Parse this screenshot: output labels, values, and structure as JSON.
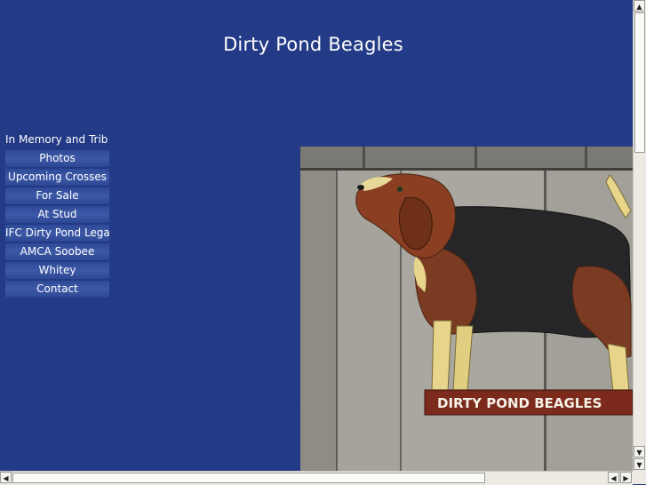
{
  "site": {
    "title": "Dirty Pond Beagles"
  },
  "nav": {
    "items": [
      {
        "label": "In Memory and Trib"
      },
      {
        "label": "Photos"
      },
      {
        "label": "Upcoming Crosses"
      },
      {
        "label": "For Sale"
      },
      {
        "label": "At Stud"
      },
      {
        "label": "IFC Dirty Pond Lega"
      },
      {
        "label": "AMCA Soobee"
      },
      {
        "label": "Whitey"
      },
      {
        "label": "Contact"
      }
    ]
  },
  "hero": {
    "sign_text": "DIRTY POND BEAGLES"
  },
  "colors": {
    "background": "#223a86",
    "nav": "#3a56a3",
    "text": "#ffffff"
  },
  "icons": {
    "scroll_up": "▲",
    "scroll_down": "▼",
    "scroll_left": "◀",
    "scroll_right": "▶"
  }
}
